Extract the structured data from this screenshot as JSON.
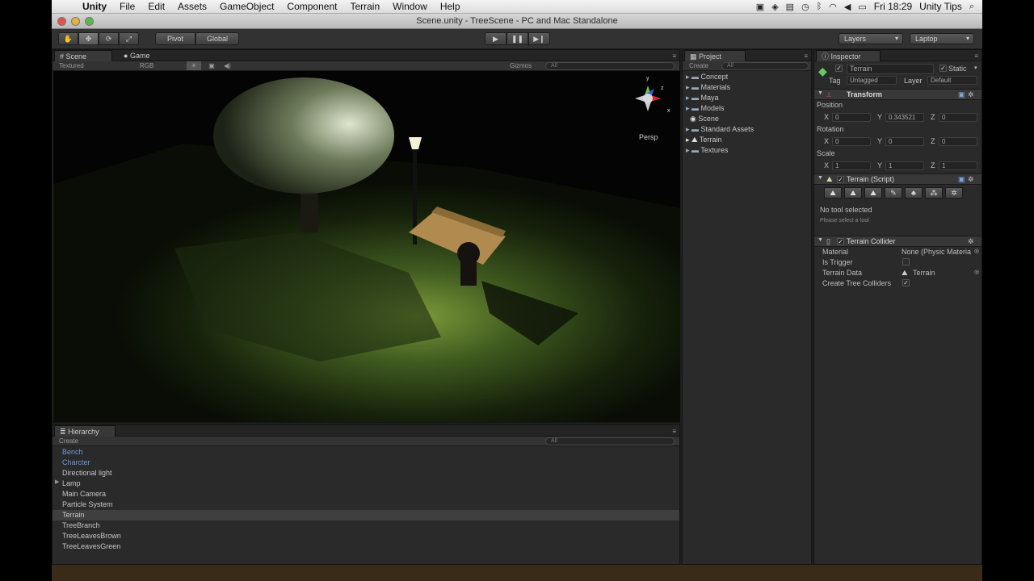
{
  "menubar": {
    "app": "Unity",
    "items": [
      "File",
      "Edit",
      "Assets",
      "GameObject",
      "Component",
      "Terrain",
      "Window",
      "Help"
    ],
    "clock": "Fri 18:29",
    "right_label": "Unity Tips"
  },
  "window": {
    "title": "Scene.unity - TreeScene - PC and Mac Standalone"
  },
  "toolbar": {
    "pivot_label": "Pivot",
    "global_label": "Global",
    "layers_label": "Layers",
    "layout_label": "Laptop"
  },
  "scene": {
    "tab_scene": "Scene",
    "tab_game": "Game",
    "render_mode": "Textured",
    "color_mode": "RGB",
    "gizmos_label": "Gizmos",
    "search_placeholder": "All",
    "persp_label": "Persp",
    "axis_y": "y",
    "axis_z": "z",
    "axis_x": "x"
  },
  "hierarchy": {
    "tab": "Hierarchy",
    "create_label": "Create",
    "search_placeholder": "All",
    "items": [
      "Bench",
      "Charcter",
      "Directional light",
      "Lamp",
      "Main Camera",
      "Particle System",
      "Terrain",
      "TreeBranch",
      "TreeLeavesBrown",
      "TreeLeavesGreen"
    ]
  },
  "project": {
    "tab": "Project",
    "create_label": "Create",
    "search_placeholder": "All",
    "items": [
      "Concept",
      "Materials",
      "Maya",
      "Models",
      "Scene",
      "Standard Assets",
      "Terrain",
      "Textures"
    ]
  },
  "inspector": {
    "tab": "Inspector",
    "object_name": "Terrain",
    "static_label": "Static",
    "tag_label": "Tag",
    "tag_value": "Untagged",
    "layer_label": "Layer",
    "layer_value": "Default",
    "transform": {
      "title": "Transform",
      "position_label": "Position",
      "rotation_label": "Rotation",
      "scale_label": "Scale",
      "x_label": "X",
      "y_label": "Y",
      "z_label": "Z",
      "position": [
        "0",
        "0.343521",
        "0"
      ],
      "rotation": [
        "0",
        "0",
        "0"
      ],
      "scale": [
        "1",
        "1",
        "1"
      ]
    },
    "terrain_script": {
      "title": "Terrain (Script)",
      "status": "No tool selected",
      "hint": "Please select a tool"
    },
    "terrain_collider": {
      "title": "Terrain Collider",
      "material_label": "Material",
      "material_value": "None (Physic Materia",
      "is_trigger_label": "Is Trigger",
      "terrain_data_label": "Terrain Data",
      "terrain_data_value": "Terrain",
      "create_tree_colliders_label": "Create Tree Colliders"
    }
  }
}
